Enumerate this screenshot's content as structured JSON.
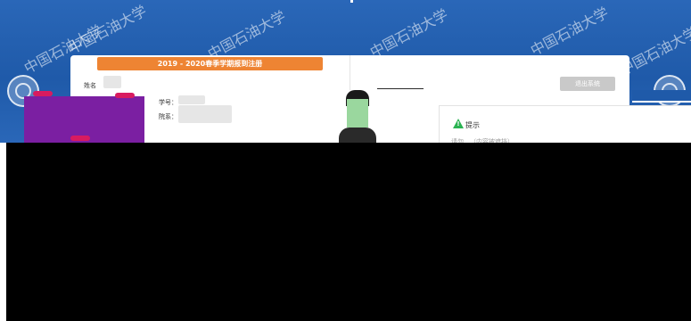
{
  "banner": {
    "watermark_text": "中国石油大学",
    "colors": {
      "primary": "#1f5aa9",
      "accent": "#ee8433",
      "mask": "#000000"
    }
  },
  "registration": {
    "term_title": "2019 - 2020春季学期报到注册",
    "name_label": "姓名",
    "student_id_label": "学号：",
    "department_label": "院系：",
    "logout_button": "退出系统"
  },
  "dialog": {
    "icon": "warning-triangle-icon",
    "title": "提示",
    "message": "请勿…（内容被遮挡）"
  }
}
